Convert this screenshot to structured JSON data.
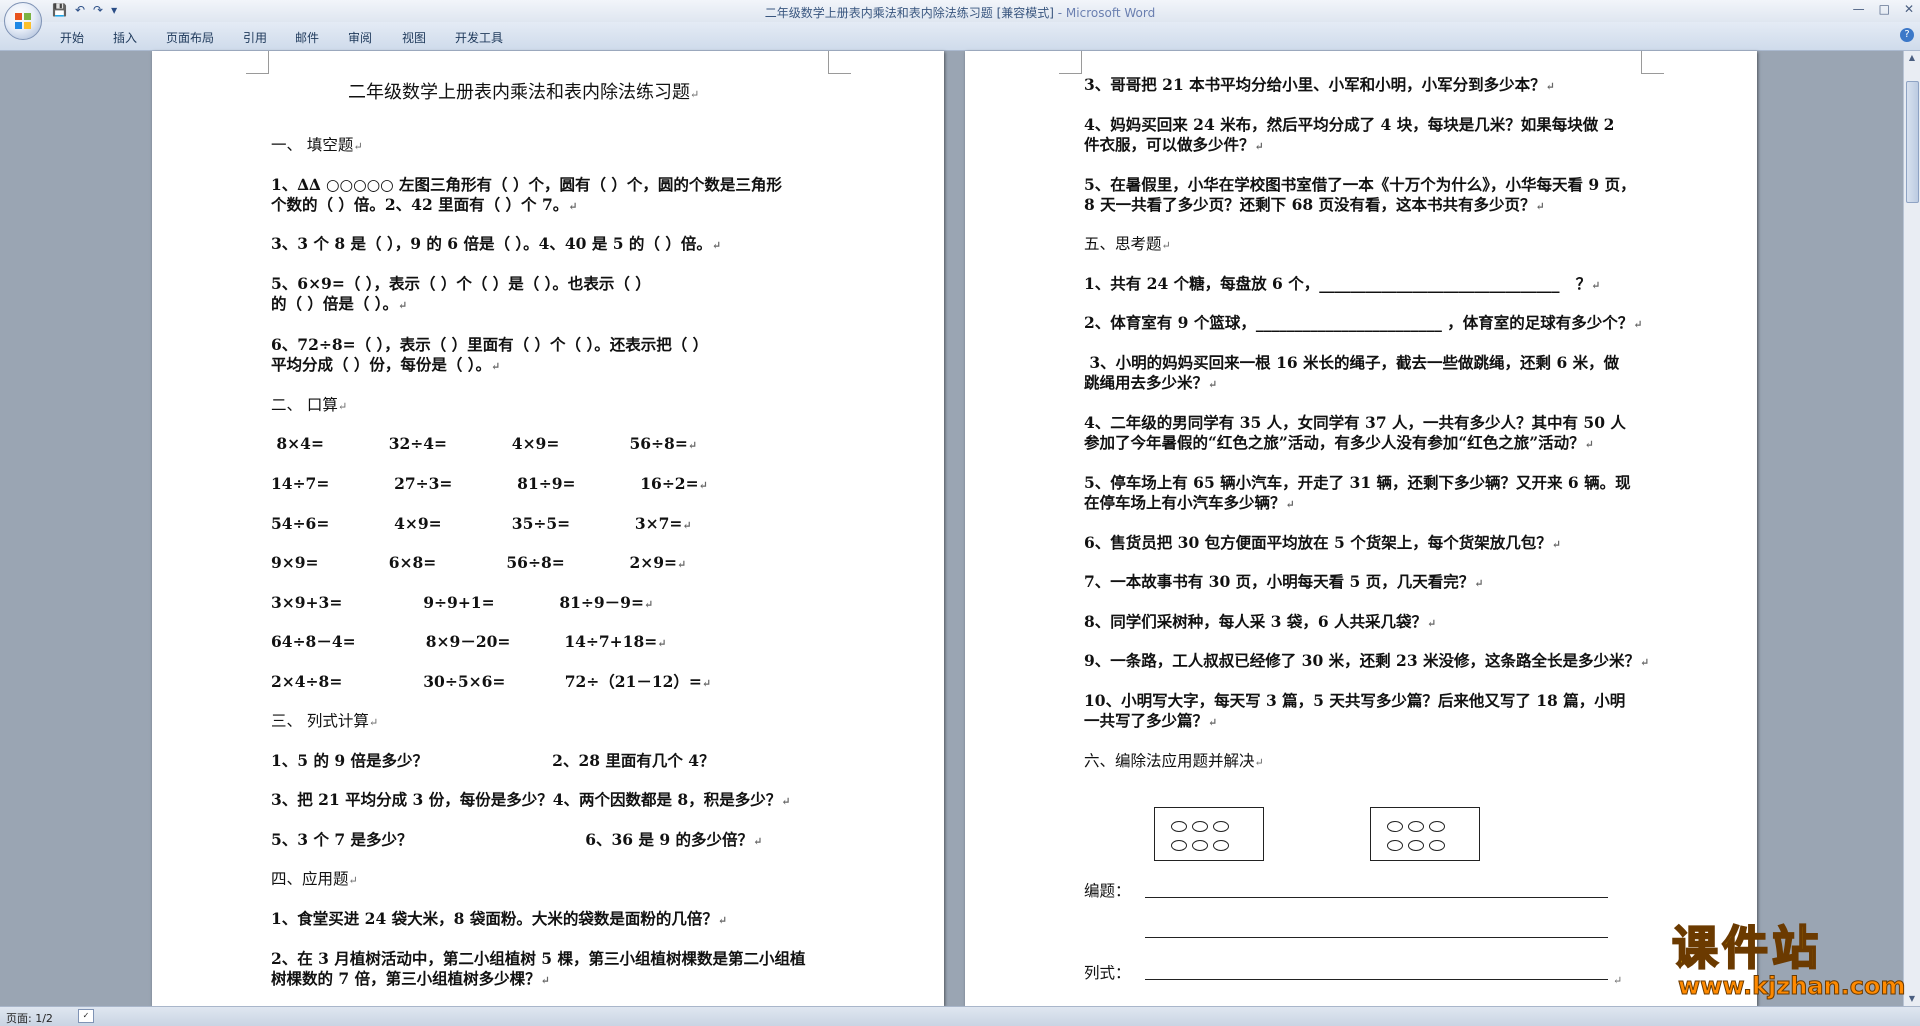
{
  "window": {
    "title": "二年级数学上册表内乘法和表内除法练习题 [兼容模式]",
    "app": " - Microsoft Word"
  },
  "ribbon": {
    "tabs": [
      "开始",
      "插入",
      "页面布局",
      "引用",
      "邮件",
      "审阅",
      "视图",
      "开发工具"
    ]
  },
  "status": {
    "page": "页面: 1/2"
  },
  "watermark": {
    "cn": "课件站",
    "url": "www.kjzhan.com"
  },
  "left_page": {
    "title": "二年级数学上册表内乘法和表内除法练习题",
    "lines": [
      "一、 填空题",
      "1、∆∆ ○○○○○ 左图三角形有（  ）个，圆有（   ）个，圆的个数是三角形",
      "个数的（      ）倍。2、42 里面有（      ）个 7。",
      "3、3 个 8 是（      ），9 的 6 倍是（      ）。4、40 是 5 的（    ）倍。",
      "5、6×9=（    ），表示（      ）个（      ）是（      ）。也表示（      ）",
      "的（     ）倍是（      ）。",
      "6、72÷8=（    ），表示（    ）里面有（      ）个（     ）。还表示把（      ）",
      "平均分成（      ）份，每份是（      ）。",
      "二、 口算",
      " 8×4=            32÷4=            4×9=             56÷8=",
      "14÷7=            27÷3=            81÷9=            16÷2=",
      "54÷6=            4×9=             35÷5=            3×7=",
      "9×9=             6×8=             56÷8=            2×9=",
      "3×9+3=               9÷9+1=            81÷9－9=",
      "64÷8－4=             8×9－20=          14÷7+18=",
      "2×4÷8=               30÷5×6=           72÷（21－12）=",
      "三、 列式计算",
      "1、5 的 9 倍是多少？                       2、28 里面有几个 4？",
      "3、把 21 平均分成 3 份，每份是多少？4、两个因数都是 8，积是多少？",
      "5、3 个 7 是多少？                                6、36 是 9 的多少倍？",
      "四、应用题",
      "1、食堂买进 24 袋大米，8 袋面粉。大米的袋数是面粉的几倍？",
      "2、在 3 月植树活动中，第二小组植树 5 棵，第三小组植树棵数是第二小组植",
      "树棵数的 7 倍，第三小组植树多少棵？"
    ]
  },
  "right_page": {
    "lines": [
      "3、哥哥把 21 本书平均分给小里、小军和小明，小军分到多少本？",
      "4、妈妈买回来 24 米布，然后平均分成了 4 块，每块是几米？如果每块做 2",
      "件衣服，可以做多少件？",
      "5、在暑假里，小华在学校图书室借了一本《十万个为什么》，小华每天看 9 页，",
      "8 天一共看了多少页？还剩下 68 页没有看，这本书共有多少页？",
      "五、思考题",
      "1、共有 24 个糖，每盘放 6 个，_______________________________   ？",
      "2、体育室有 9 个篮球，________________________ ，体育室的足球有多少个？",
      " 3、小明的妈妈买回来一根 16 米长的绳子，截去一些做跳绳，还剩 6 米，做",
      "跳绳用去多少米？",
      "4、二年级的男同学有 35 人，女同学有 37 人，一共有多少人？其中有 50 人",
      "参加了今年暑假的“红色之旅”活动，有多少人没有参加“红色之旅”活动？",
      "5、停车场上有 65 辆小汽车，开走了 31 辆，还剩下多少辆？又开来 6 辆。现",
      "在停车场上有小汽车多少辆？",
      "6、售货员把 30 包方便面平均放在 5 个货架上，每个货架放几包？",
      "7、一本故事书有 30 页，小明每天看 5 页，几天看完？",
      "8、同学们采树种，每人采 3 袋，6 人共采几袋？",
      "9、一条路，工人叔叔已经修了 30 米，还剩 23 米没修，这条路全长是多少米？",
      "10、小明写大字，每天写 3 篇，5 天共写多少篇？后来他又写了 18 篇，小明",
      "一共写了多少篇？",
      "六、编除法应用题并解决",
      "编题：",
      "列式："
    ]
  }
}
